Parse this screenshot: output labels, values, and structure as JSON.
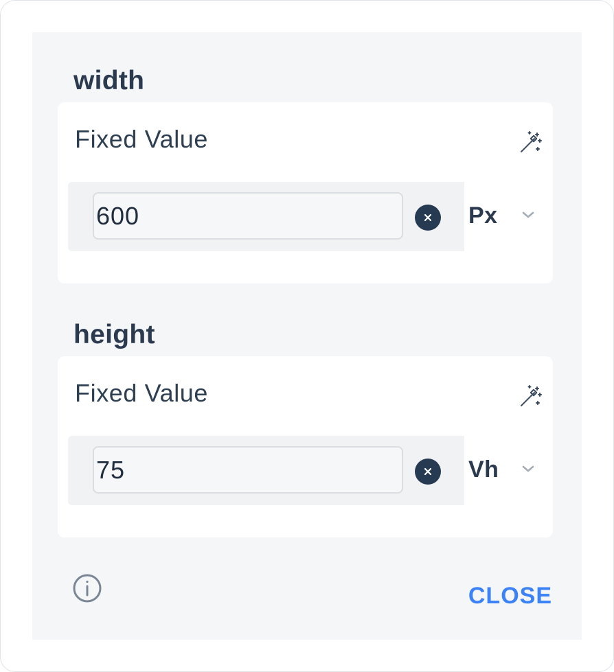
{
  "width_section": {
    "title": "width",
    "mode_label": "Fixed Value",
    "value": "600",
    "unit": "Px"
  },
  "height_section": {
    "title": "height",
    "mode_label": "Fixed Value",
    "value": "75",
    "unit": "Vh"
  },
  "footer": {
    "close_label": "CLOSE"
  },
  "icons": {
    "magic": "magic-wand-icon",
    "clear": "close-circle-icon",
    "dropdown": "chevron-down-icon",
    "info": "info-icon"
  },
  "colors": {
    "accent": "#3b82f6",
    "text": "#2b3a4e",
    "panel_bg": "#f5f6f8",
    "clear_button": "#263a52"
  }
}
